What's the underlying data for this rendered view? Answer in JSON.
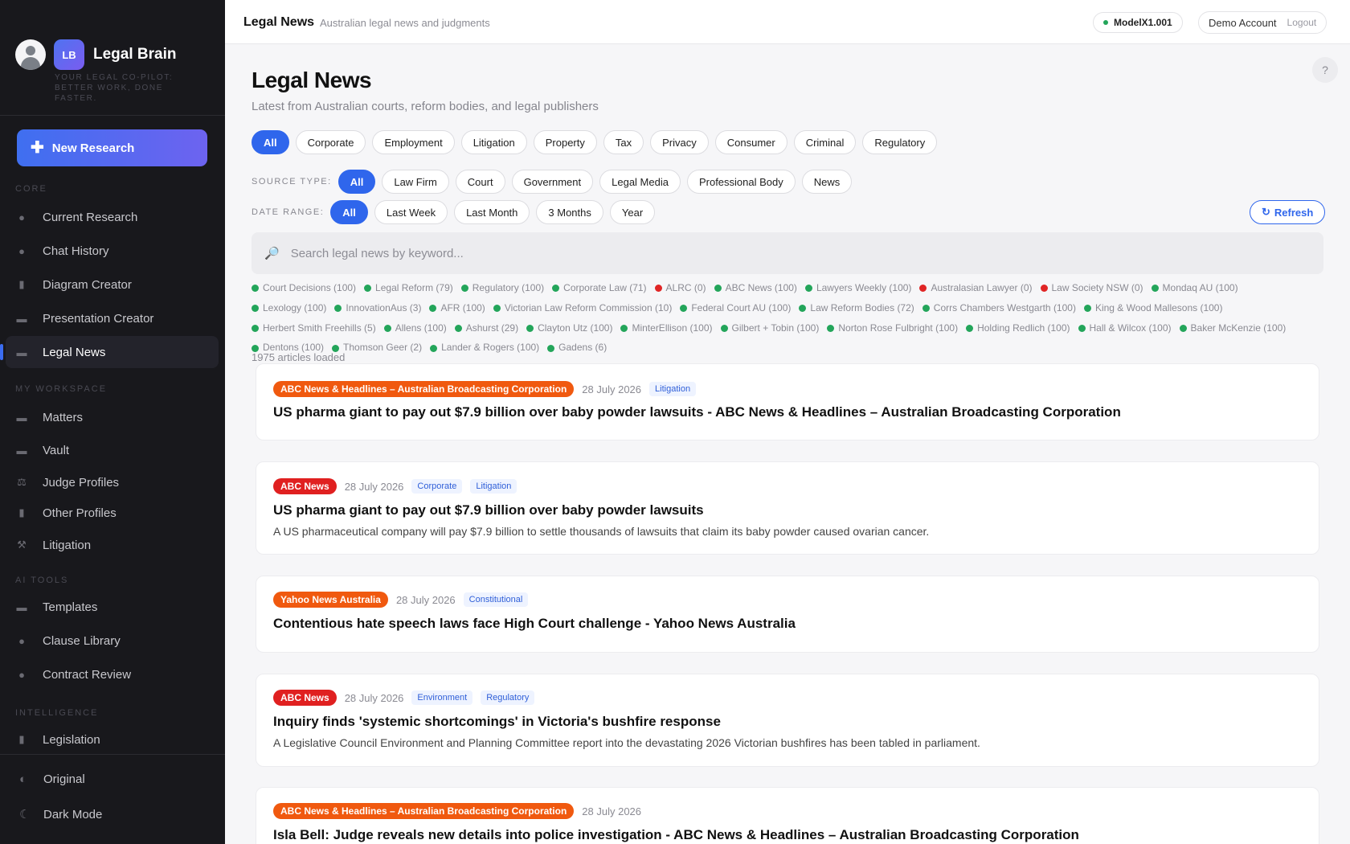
{
  "sidebar": {
    "brand": {
      "logo_text": "LB",
      "name": "Legal Brain",
      "tagline": "YOUR LEGAL CO-PILOT: BETTER WORK, DONE FASTER."
    },
    "new_research_label": "New Research",
    "sections": {
      "core": "CORE",
      "workspace": "MY WORKSPACE",
      "ai_tools": "AI TOOLS",
      "intelligence": "INTELLIGENCE"
    },
    "items": {
      "current_research": "Current Research",
      "chat_history": "Chat History",
      "diagram_creator": "Diagram Creator",
      "presentation_creator": "Presentation Creator",
      "legal_news": "Legal News",
      "matters": "Matters",
      "vault": "Vault",
      "judge_profiles": "Judge Profiles",
      "other_profiles": "Other Profiles",
      "litigation": "Litigation",
      "templates": "Templates",
      "clause_library": "Clause Library",
      "contract_review": "Contract Review",
      "legislation": "Legislation"
    },
    "active_item": "Legal News",
    "bottom": {
      "original": "Original",
      "dark_mode": "Dark Mode"
    }
  },
  "topbar": {
    "title": "Legal News",
    "subtitle": "Australian legal news and judgments",
    "model": "ModelX1.001",
    "account": "Demo Account",
    "logout": "Logout"
  },
  "main": {
    "help_label": "?",
    "title": "Legal News",
    "subtitle": "Latest from Australian courts, reform bodies, and legal publishers",
    "categories": [
      "All",
      "Corporate",
      "Employment",
      "Litigation",
      "Property",
      "Tax",
      "Privacy",
      "Consumer",
      "Criminal",
      "Regulatory"
    ],
    "source_type_label": "SOURCE TYPE:",
    "source_types": [
      "All",
      "Law Firm",
      "Court",
      "Government",
      "Legal Media",
      "Professional Body",
      "News"
    ],
    "date_range_label": "DATE RANGE:",
    "date_ranges": [
      "All",
      "Last Week",
      "Last Month",
      "3 Months",
      "Year"
    ],
    "refresh_label": "Refresh",
    "search_placeholder": "Search legal news by keyword...",
    "sources": [
      {
        "label": "Court Decisions (100)",
        "status": "ok"
      },
      {
        "label": "Legal Reform (79)",
        "status": "ok"
      },
      {
        "label": "Regulatory (100)",
        "status": "ok"
      },
      {
        "label": "Corporate Law (71)",
        "status": "ok"
      },
      {
        "label": "ALRC (0)",
        "status": "error"
      },
      {
        "label": "ABC News (100)",
        "status": "ok"
      },
      {
        "label": "Lawyers Weekly (100)",
        "status": "ok"
      },
      {
        "label": "Australasian Lawyer (0)",
        "status": "error"
      },
      {
        "label": "Law Society NSW (0)",
        "status": "error"
      },
      {
        "label": "Mondaq AU (100)",
        "status": "ok"
      },
      {
        "label": "Lexology (100)",
        "status": "ok"
      },
      {
        "label": "InnovationAus (3)",
        "status": "ok"
      },
      {
        "label": "AFR (100)",
        "status": "ok"
      },
      {
        "label": "Victorian Law Reform Commission (10)",
        "status": "ok"
      },
      {
        "label": "Federal Court AU (100)",
        "status": "ok"
      },
      {
        "label": "Law Reform Bodies (72)",
        "status": "ok"
      },
      {
        "label": "Corrs Chambers Westgarth (100)",
        "status": "ok"
      },
      {
        "label": "King & Wood Mallesons (100)",
        "status": "ok"
      },
      {
        "label": "Herbert Smith Freehills (5)",
        "status": "ok"
      },
      {
        "label": "Allens (100)",
        "status": "ok"
      },
      {
        "label": "Ashurst (29)",
        "status": "ok"
      },
      {
        "label": "Clayton Utz (100)",
        "status": "ok"
      },
      {
        "label": "MinterEllison (100)",
        "status": "ok"
      },
      {
        "label": "Gilbert + Tobin (100)",
        "status": "ok"
      },
      {
        "label": "Norton Rose Fulbright (100)",
        "status": "ok"
      },
      {
        "label": "Holding Redlich (100)",
        "status": "ok"
      },
      {
        "label": "Hall & Wilcox (100)",
        "status": "ok"
      },
      {
        "label": "Baker McKenzie (100)",
        "status": "ok"
      },
      {
        "label": "Dentons (100)",
        "status": "ok"
      },
      {
        "label": "Thomson Geer (2)",
        "status": "ok"
      },
      {
        "label": "Lander & Rogers (100)",
        "status": "ok"
      },
      {
        "label": "Gadens (6)",
        "status": "ok"
      }
    ],
    "articles_loaded": "1975 articles loaded",
    "articles": [
      {
        "source": "ABC News & Headlines – Australian Broadcasting Corporation",
        "source_color": "#f0590f",
        "date": "28 July 2026",
        "tags": [
          "Litigation"
        ],
        "title": "US pharma giant to pay out $7.9 billion over baby powder lawsuits - ABC News & Headlines – Australian Broadcasting Corporation",
        "desc": ""
      },
      {
        "source": "ABC News",
        "source_color": "#e02020",
        "date": "28 July 2026",
        "tags": [
          "Corporate",
          "Litigation"
        ],
        "title": "US pharma giant to pay out $7.9 billion over baby powder lawsuits",
        "desc": "A US pharmaceutical company will pay $7.9 billion to settle thousands of lawsuits that claim its baby powder caused ovarian cancer."
      },
      {
        "source": "Yahoo News Australia",
        "source_color": "#f0590f",
        "date": "28 July 2026",
        "tags": [
          "Constitutional"
        ],
        "title": "Contentious hate speech laws face High Court challenge - Yahoo News Australia",
        "desc": ""
      },
      {
        "source": "ABC News",
        "source_color": "#e02020",
        "date": "28 July 2026",
        "tags": [
          "Environment",
          "Regulatory"
        ],
        "title": "Inquiry finds 'systemic shortcomings' in Victoria's bushfire response",
        "desc": "A Legislative Council Environment and Planning Committee report into the devastating 2026 Victorian bushfires has been tabled in parliament."
      },
      {
        "source": "ABC News & Headlines – Australian Broadcasting Corporation",
        "source_color": "#f0590f",
        "date": "28 July 2026",
        "tags": [],
        "title": "Isla Bell: Judge reveals new details into police investigation - ABC News & Headlines – Australian Broadcasting Corporation",
        "desc": ""
      }
    ]
  },
  "colors": {
    "accent": "#2f66ec",
    "sidebar_bg": "#18181c",
    "status_ok": "#23a55a",
    "status_error": "#e02525"
  }
}
